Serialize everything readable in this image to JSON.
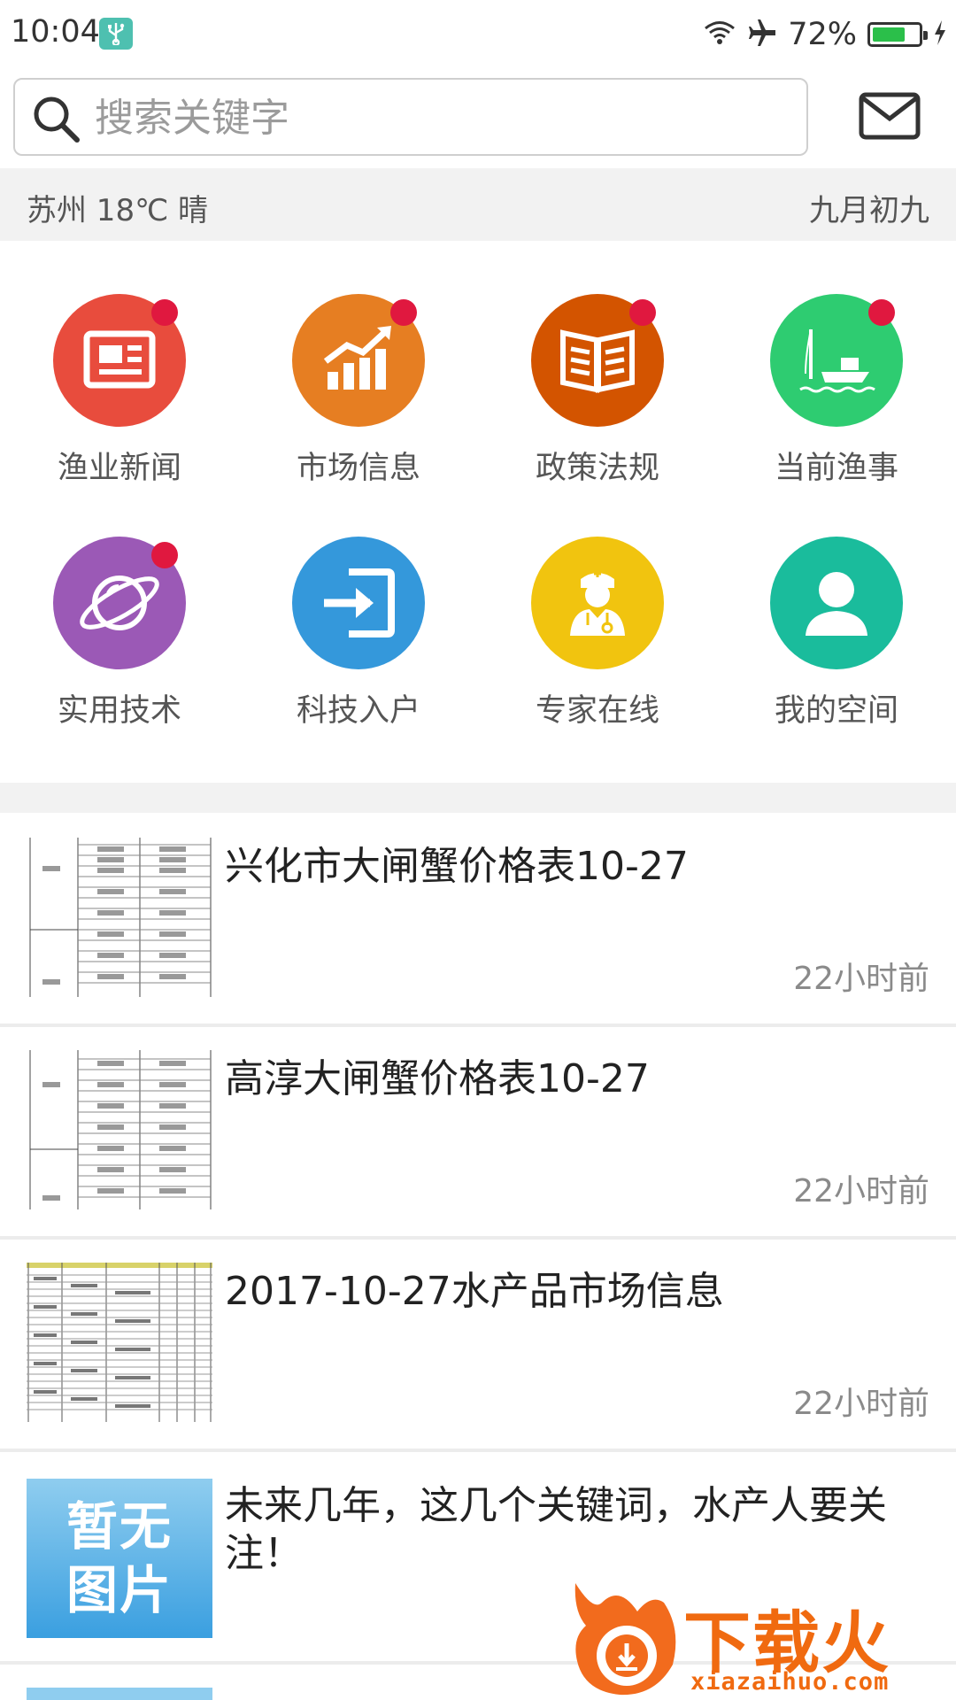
{
  "status_bar": {
    "time": "10:04",
    "battery_percent": "72%",
    "battery_level": 0.72
  },
  "search": {
    "placeholder": "搜索关键字"
  },
  "weather": {
    "location_weather": "苏州  18℃ 晴",
    "lunar_date": "九月初九"
  },
  "grid": [
    {
      "label": "渔业新闻",
      "icon": "newspaper-icon",
      "color": "#e84c3d",
      "badge": true
    },
    {
      "label": "市场信息",
      "icon": "chart-up-icon",
      "color": "#e67e22",
      "badge": true
    },
    {
      "label": "政策法规",
      "icon": "open-book-icon",
      "color": "#d35400",
      "badge": true
    },
    {
      "label": "当前渔事",
      "icon": "fishing-boat-icon",
      "color": "#2ecc71",
      "badge": true
    },
    {
      "label": "实用技术",
      "icon": "planet-icon",
      "color": "#9b59b6",
      "badge": true
    },
    {
      "label": "科技入户",
      "icon": "login-arrow-icon",
      "color": "#3498db",
      "badge": false
    },
    {
      "label": "专家在线",
      "icon": "doctor-icon",
      "color": "#f1c40f",
      "badge": false
    },
    {
      "label": "我的空间",
      "icon": "user-icon",
      "color": "#1abc9c",
      "badge": false
    }
  ],
  "news": [
    {
      "title": "兴化市大闸蟹价格表10-27",
      "time": "22小时前",
      "thumb": "price-table"
    },
    {
      "title": "高淳大闸蟹价格表10-27",
      "time": "22小时前",
      "thumb": "price-table"
    },
    {
      "title": "2017-10-27水产品市场信息",
      "time": "22小时前",
      "thumb": "market-table"
    },
    {
      "title": "未来几年，这几个关键词，水产人要关注！",
      "time": "",
      "thumb": "no-image",
      "no_image_text": "暂无图片"
    }
  ],
  "watermark": {
    "text": "下载火",
    "url": "xiazaihuo.com"
  }
}
